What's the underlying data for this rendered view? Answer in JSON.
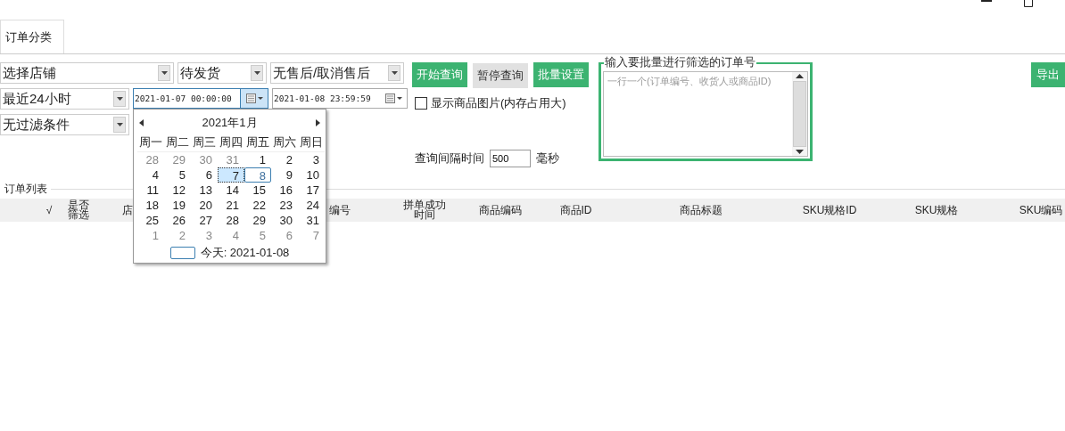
{
  "tabs": [
    {
      "label": "订单分类",
      "selected": true
    }
  ],
  "filters": {
    "row_1": [
      {
        "value": "选择店铺"
      },
      {
        "value": "待发货"
      },
      {
        "value": "无售后/取消售后"
      }
    ],
    "row_2_range": {
      "value": "最近24小时"
    },
    "start_date": {
      "value": "2021-01-07 00:00:00",
      "focused": true
    },
    "end_date": {
      "value": "2021-01-08 23:59:59",
      "focused": false
    },
    "row_3": {
      "value": "无过滤条件"
    }
  },
  "buttons": [
    {
      "label": "开始查询",
      "kind": "primary"
    },
    {
      "label": "暂停查询",
      "kind": "secondary"
    },
    {
      "label": "批量设置",
      "kind": "primary"
    }
  ],
  "show_images": {
    "label": "显示商品图片(内存占用大)",
    "checked": false
  },
  "interval": {
    "label": "查询间隔时间",
    "value": "500",
    "unit": "毫秒"
  },
  "batch_group": {
    "title": "输入要批量进行筛选的订单号",
    "placeholder": "一行一个(订单编号、收货人或商品ID)"
  },
  "export_button": "导出",
  "order_list": {
    "title": "订单列表",
    "columns": [
      "√",
      "是否筛选",
      "店",
      "编号",
      "拼单成功时间",
      "商品编码",
      "商品ID",
      "商品标题",
      "SKU规格ID",
      "SKU规格",
      "SKU编码"
    ]
  },
  "calendar": {
    "month": "2021年1月",
    "weekdays": [
      "周一",
      "周二",
      "周三",
      "周四",
      "周五",
      "周六",
      "周日"
    ],
    "days": [
      {
        "day": "28",
        "muted": true,
        "selected": false,
        "today": false
      },
      {
        "day": "29",
        "muted": true,
        "selected": false,
        "today": false
      },
      {
        "day": "30",
        "muted": true,
        "selected": false,
        "today": false
      },
      {
        "day": "31",
        "muted": true,
        "selected": false,
        "today": false
      },
      {
        "day": "1",
        "muted": false,
        "selected": false,
        "today": false
      },
      {
        "day": "2",
        "muted": false,
        "selected": false,
        "today": false
      },
      {
        "day": "3",
        "muted": false,
        "selected": false,
        "today": false
      },
      {
        "day": "4",
        "muted": false,
        "selected": false,
        "today": false
      },
      {
        "day": "5",
        "muted": false,
        "selected": false,
        "today": false
      },
      {
        "day": "6",
        "muted": false,
        "selected": false,
        "today": false
      },
      {
        "day": "7",
        "muted": false,
        "selected": true,
        "today": false
      },
      {
        "day": "8",
        "muted": false,
        "selected": false,
        "today": true
      },
      {
        "day": "9",
        "muted": false,
        "selected": false,
        "today": false
      },
      {
        "day": "10",
        "muted": false,
        "selected": false,
        "today": false
      },
      {
        "day": "11",
        "muted": false,
        "selected": false,
        "today": false
      },
      {
        "day": "12",
        "muted": false,
        "selected": false,
        "today": false
      },
      {
        "day": "13",
        "muted": false,
        "selected": false,
        "today": false
      },
      {
        "day": "14",
        "muted": false,
        "selected": false,
        "today": false
      },
      {
        "day": "15",
        "muted": false,
        "selected": false,
        "today": false
      },
      {
        "day": "16",
        "muted": false,
        "selected": false,
        "today": false
      },
      {
        "day": "17",
        "muted": false,
        "selected": false,
        "today": false
      },
      {
        "day": "18",
        "muted": false,
        "selected": false,
        "today": false
      },
      {
        "day": "19",
        "muted": false,
        "selected": false,
        "today": false
      },
      {
        "day": "20",
        "muted": false,
        "selected": false,
        "today": false
      },
      {
        "day": "21",
        "muted": false,
        "selected": false,
        "today": false
      },
      {
        "day": "22",
        "muted": false,
        "selected": false,
        "today": false
      },
      {
        "day": "23",
        "muted": false,
        "selected": false,
        "today": false
      },
      {
        "day": "24",
        "muted": false,
        "selected": false,
        "today": false
      },
      {
        "day": "25",
        "muted": false,
        "selected": false,
        "today": false
      },
      {
        "day": "26",
        "muted": false,
        "selected": false,
        "today": false
      },
      {
        "day": "27",
        "muted": false,
        "selected": false,
        "today": false
      },
      {
        "day": "28",
        "muted": false,
        "selected": false,
        "today": false
      },
      {
        "day": "29",
        "muted": false,
        "selected": false,
        "today": false
      },
      {
        "day": "30",
        "muted": false,
        "selected": false,
        "today": false
      },
      {
        "day": "31",
        "muted": false,
        "selected": false,
        "today": false
      },
      {
        "day": "1",
        "muted": true,
        "selected": false,
        "today": false
      },
      {
        "day": "2",
        "muted": true,
        "selected": false,
        "today": false
      },
      {
        "day": "3",
        "muted": true,
        "selected": false,
        "today": false
      },
      {
        "day": "4",
        "muted": true,
        "selected": false,
        "today": false
      },
      {
        "day": "5",
        "muted": true,
        "selected": false,
        "today": false
      },
      {
        "day": "6",
        "muted": true,
        "selected": false,
        "today": false
      },
      {
        "day": "7",
        "muted": true,
        "selected": false,
        "today": false
      }
    ],
    "today_label": "今天: 2021-01-08"
  }
}
